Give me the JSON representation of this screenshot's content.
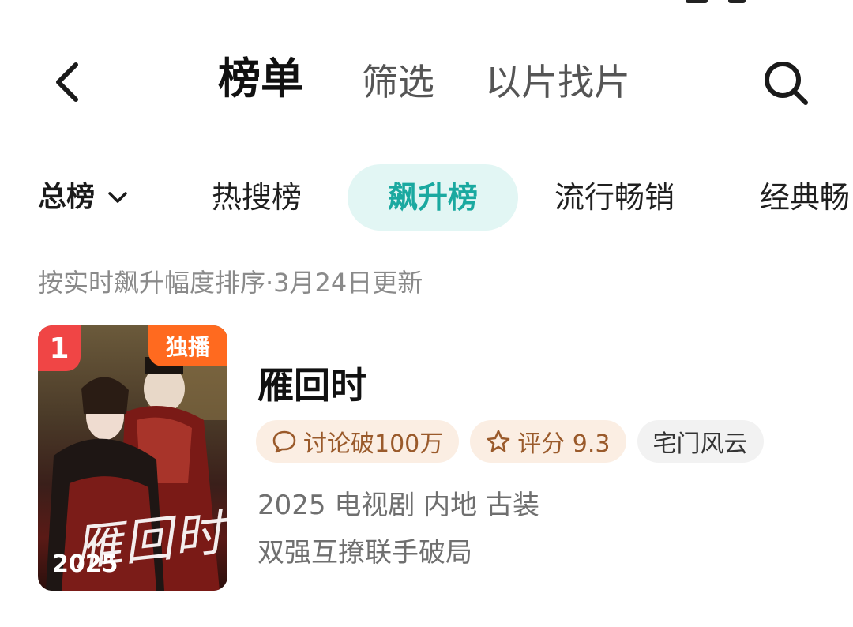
{
  "header": {
    "tabs": [
      {
        "label": "榜单"
      },
      {
        "label": "筛选"
      },
      {
        "label": "以片找片"
      }
    ]
  },
  "categories": {
    "total_label": "总榜",
    "items": [
      "热搜榜",
      "飙升榜",
      "流行畅销",
      "经典畅"
    ],
    "active": "飙升榜"
  },
  "subtitle": "按实时飙升幅度排序·3月24日更新",
  "list": [
    {
      "rank": "1",
      "badge": "独播",
      "poster_year": "2025",
      "poster_title": "雁回时",
      "title": "雁回时",
      "tags": [
        {
          "label": "讨论破100万",
          "icon": "chat-bubble-icon"
        },
        {
          "label": "评分 9.3",
          "icon": "star-icon"
        },
        {
          "label": "宅门风云"
        }
      ],
      "meta": "2025 电视剧 内地 古装",
      "description": "双强互撩联手破局"
    }
  ],
  "colors": {
    "accent_teal": "#1aa9a0",
    "accent_teal_bg": "#e2f6f4",
    "rank_red": "#f04545",
    "badge_orange": "#ff6a1f",
    "tag_warm_bg": "#fbeee3",
    "tag_warm_text": "#9a5a2b"
  }
}
